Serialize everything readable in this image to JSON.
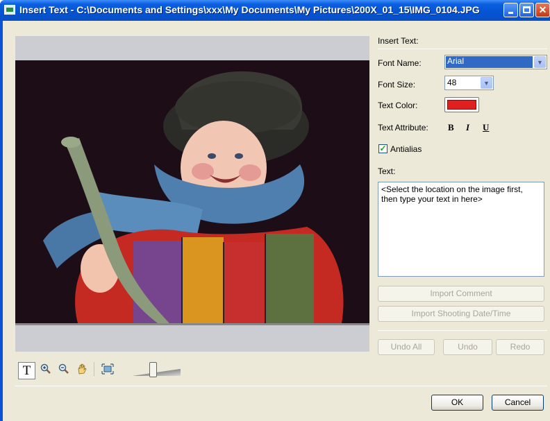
{
  "window": {
    "title": "Insert Text - C:\\Documents and Settings\\xxx\\My Documents\\My Pictures\\200X_01_15\\IMG_0104.JPG"
  },
  "panel": {
    "section_title": "Insert Text:",
    "font_name_label": "Font Name:",
    "font_name_value": "Arial",
    "font_size_label": "Font Size:",
    "font_size_value": "48",
    "text_color_label": "Text Color:",
    "text_color": "#e02020",
    "text_attribute_label": "Text Attribute:",
    "bold_label": "B",
    "italic_label": "I",
    "underline_label": "U",
    "antialias_label": "Antialias",
    "antialias_checked": true,
    "text_label": "Text:",
    "text_placeholder": "<Select the location on the image first, then type your text in here>",
    "import_comment_label": "Import Comment",
    "import_date_label": "Import Shooting Date/Time",
    "undo_all_label": "Undo All",
    "undo_label": "Undo",
    "redo_label": "Redo"
  },
  "toolbar": {
    "text_tool_label": "T",
    "icons": [
      "text-tool-icon",
      "zoom-in-icon",
      "zoom-out-icon",
      "hand-icon",
      "fit-window-icon"
    ]
  },
  "footer": {
    "ok_label": "OK",
    "cancel_label": "Cancel"
  },
  "colors": {
    "titlebar": "#0454d4",
    "dialog_bg": "#ece9d8",
    "selection": "#316ac5"
  }
}
